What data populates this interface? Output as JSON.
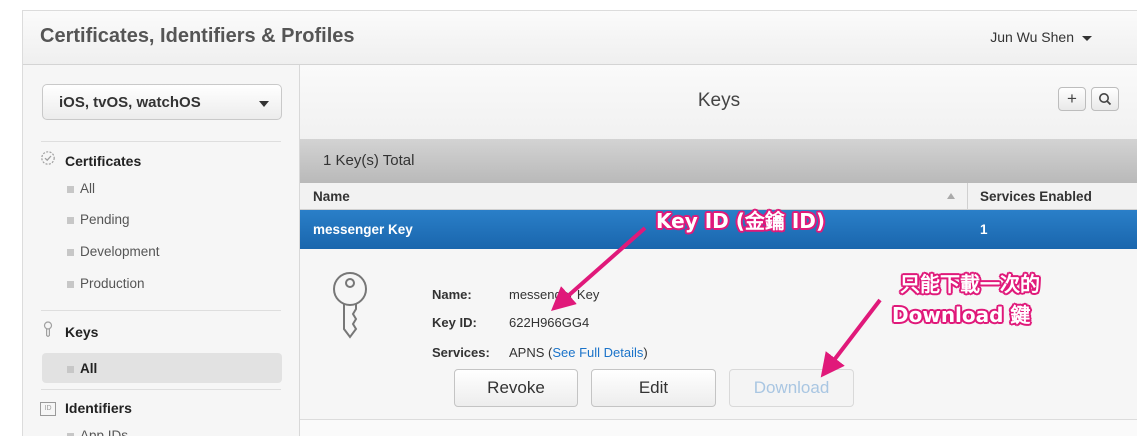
{
  "app": {
    "title": "Certificates, Identifiers & Profiles",
    "user": "Jun Wu Shen"
  },
  "sidebar": {
    "platform": "iOS, tvOS, watchOS",
    "certificates": {
      "label": "Certificates",
      "items": [
        "All",
        "Pending",
        "Development",
        "Production"
      ]
    },
    "keys": {
      "label": "Keys",
      "items": [
        "All"
      ]
    },
    "identifiers": {
      "label": "Identifiers",
      "icon_text": "ID",
      "items": [
        "App IDs"
      ]
    }
  },
  "main": {
    "title": "Keys",
    "total": "1 Key(s) Total",
    "columns": {
      "name": "Name",
      "services": "Services Enabled"
    },
    "rows": [
      {
        "name": "messenger Key",
        "services": "1"
      }
    ],
    "detail": {
      "name_label": "Name:",
      "name_value": "messenger Key",
      "keyid_label": "Key ID:",
      "keyid_value": "622H966GG4",
      "services_label": "Services:",
      "services_value": "APNS (",
      "services_link": "See Full Details",
      "services_close": ")"
    },
    "buttons": {
      "revoke": "Revoke",
      "edit": "Edit",
      "download": "Download"
    }
  },
  "annotations": {
    "key_id": "Key ID (金鑰 ID)",
    "download_line1": "只能下載一次的",
    "download_line2": "Download 鍵"
  },
  "colors": {
    "selected_row": "#1f6fb8",
    "annotation": "#e0197a",
    "link": "#1a73c9"
  }
}
